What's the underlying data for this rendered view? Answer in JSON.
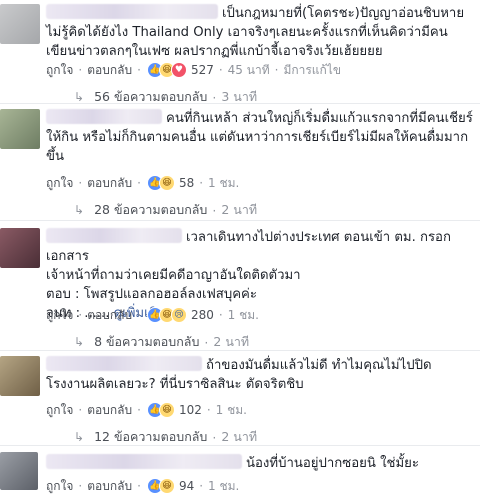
{
  "labels": {
    "like": "ถูกใจ",
    "reply": "ตอบกลับ",
    "dot": "·"
  },
  "comments": [
    {
      "avatar_color": "#b7b8bb",
      "text_line1": "เป็นกฎหมายที่(โคตรชะ)ปัญญาอ่อนชิบหาย",
      "text_rest": [
        "ไม่รู้คิดได้ยังไง Thailand Only เอาจริงๆเลยนะครั้งแรกที่เห็นคิดว่ามีคน",
        "เขียนข่าวตลกๆในเฟซ ผลปรากฏพี่แกบ้าจี้เอาจริงเว้ยเฮ้ยยยย"
      ],
      "reactions": [
        "like-icon",
        "haha-icon",
        "love-icon"
      ],
      "count": "527",
      "time": "45 นาที",
      "edited": "มีการแก้ไข",
      "replies_label": "56 ข้อความตอบกลับ",
      "replies_time": "3 นาที"
    },
    {
      "avatar_color": "#8b9a7c",
      "text_line1": "คนที่กินเหล้า ส่วนใหญ่ก็เริ่มดื่มแก้วแรกจากที่มีคนเชียร์",
      "text_rest": [
        "ให้กิน หรือไม่ก็กินตามคนอื่น แต่ดันหาว่าการเชียร์เบียร์ไม่มีผลให้คนดื่มมาก",
        "ขึ้น"
      ],
      "reactions": [
        "like-icon",
        "haha-icon"
      ],
      "count": "58",
      "time": "1 ชม.",
      "edited": "",
      "replies_label": "28 ข้อความตอบกลับ",
      "replies_time": "2 นาที"
    },
    {
      "avatar_color": "#6c4a52",
      "text_line1": "เวลาเดินทางไปต่างประเทศ ตอนเข้า ตม. กรอกเอกสาร",
      "text_rest": [
        "เจ้าหน้าที่ถามว่าเคยมีคดีอาญาอันใดติดตัวมา",
        "ตอบ : โพสรูปแอลกอฮอล์ลงเฟสบุคค่ะ"
      ],
      "text_last_prefix": "จนท : ......",
      "see_more": "ดูเพิ่มเติม",
      "reactions": [
        "like-icon",
        "haha-icon",
        "sad-icon"
      ],
      "count": "280",
      "time": "1 ชม.",
      "edited": "",
      "replies_label": "8 ข้อความตอบกลับ",
      "replies_time": "2 นาที"
    },
    {
      "avatar_color": "#9a8a6e",
      "text_line1": "ถ้าของมันดื่มแล้วไม่ดี ทำไมคุณไม่ไปปิด",
      "text_rest": [
        "โรงงานผลิตเลยวะ? ที่นี่บราซิลสินะ ตัดจริตชิบ"
      ],
      "reactions": [
        "like-icon",
        "haha-icon"
      ],
      "count": "102",
      "time": "1 ชม.",
      "edited": "",
      "replies_label": "12 ข้อความตอบกลับ",
      "replies_time": "2 นาที"
    },
    {
      "avatar_color": "#7b7f86",
      "text_line1": "น้องที่บ้านอยู่ปากซอยนิ ใช่มั้ยะ",
      "text_rest": [],
      "reactions": [
        "like-icon",
        "haha-icon"
      ],
      "count": "94",
      "time": "1 ชม.",
      "edited": "",
      "replies_label": "",
      "replies_time": ""
    }
  ]
}
